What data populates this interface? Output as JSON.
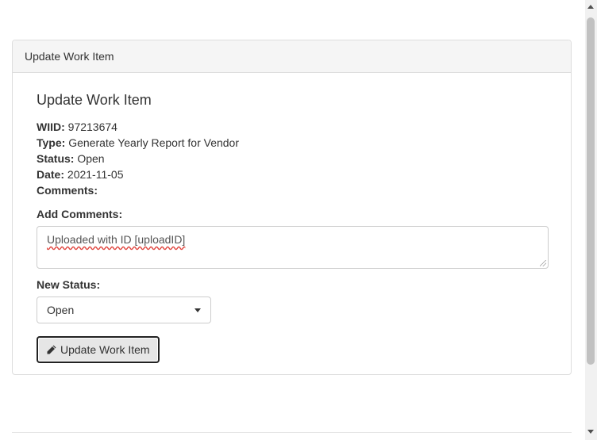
{
  "panel": {
    "heading": "Update Work Item"
  },
  "form": {
    "title": "Update Work Item",
    "wiid_label": "WIID:",
    "wiid_value": "97213674",
    "type_label": "Type:",
    "type_value": "Generate Yearly Report for Vendor",
    "status_label": "Status:",
    "status_value": "Open",
    "date_label": "Date:",
    "date_value": "2021-11-05",
    "comments_label": "Comments:",
    "add_comments_label": "Add Comments:",
    "add_comments_value": "Uploaded with ID [uploadID]",
    "new_status_label": "New Status:",
    "new_status_value": "Open",
    "submit_label": "Update Work Item"
  },
  "icons": {
    "submit_icon": "pencil-icon",
    "select_icon": "caret-down-icon"
  }
}
